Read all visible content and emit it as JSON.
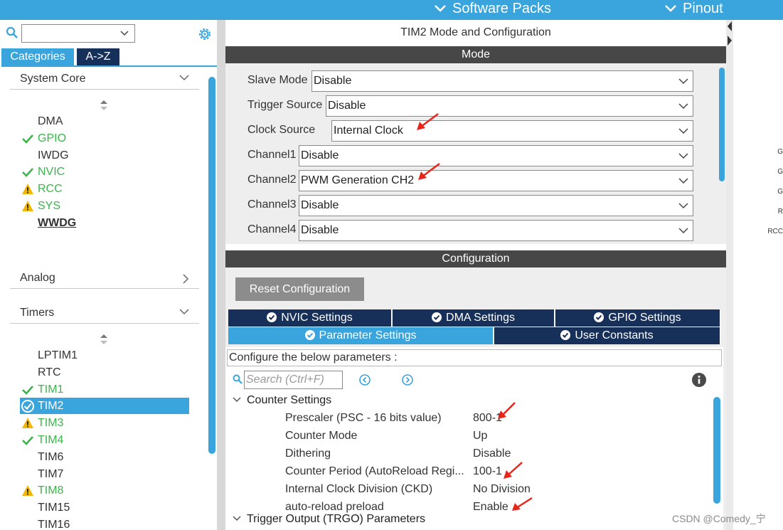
{
  "topbar": {
    "software_packs": "Software Packs",
    "pinout": "Pinout"
  },
  "left_panel": {
    "tabs": {
      "categories": "Categories",
      "az": "A->Z"
    },
    "sections": {
      "system_core": "System Core",
      "analog": "Analog",
      "timers": "Timers"
    },
    "system_core_items": [
      {
        "label": "DMA",
        "status": "normal"
      },
      {
        "label": "GPIO",
        "status": "ok"
      },
      {
        "label": "IWDG",
        "status": "normal"
      },
      {
        "label": "NVIC",
        "status": "ok"
      },
      {
        "label": "RCC",
        "status": "warning"
      },
      {
        "label": "SYS",
        "status": "warning"
      },
      {
        "label": "WWDG",
        "status": "bold"
      }
    ],
    "timer_items": [
      {
        "label": "LPTIM1",
        "status": "normal"
      },
      {
        "label": "RTC",
        "status": "normal"
      },
      {
        "label": "TIM1",
        "status": "ok"
      },
      {
        "label": "TIM2",
        "status": "selected"
      },
      {
        "label": "TIM3",
        "status": "warning"
      },
      {
        "label": "TIM4",
        "status": "ok"
      },
      {
        "label": "TIM6",
        "status": "normal"
      },
      {
        "label": "TIM7",
        "status": "normal"
      },
      {
        "label": "TIM8",
        "status": "warning"
      },
      {
        "label": "TIM15",
        "status": "normal"
      },
      {
        "label": "TIM16",
        "status": "normal"
      }
    ]
  },
  "center": {
    "title": "TIM2 Mode and Configuration",
    "mode_bar": "Mode",
    "mode_rows": [
      {
        "label": "Slave Mode",
        "value": "Disable"
      },
      {
        "label": "Trigger Source",
        "value": "Disable"
      },
      {
        "label": "Clock Source",
        "value": "Internal Clock"
      },
      {
        "label": "Channel1",
        "value": "Disable"
      },
      {
        "label": "Channel2",
        "value": "PWM Generation CH2"
      },
      {
        "label": "Channel3",
        "value": "Disable"
      },
      {
        "label": "Channel4",
        "value": "Disable"
      }
    ],
    "config_bar": "Configuration",
    "reset_button": "Reset Configuration",
    "config_tabs": {
      "nvic": "NVIC Settings",
      "dma": "DMA Settings",
      "gpio": "GPIO Settings",
      "params": "Parameter Settings",
      "user_constants": "User Constants"
    },
    "params_header": "Configure the below parameters :",
    "search_placeholder": "Search (Ctrl+F)",
    "counter_group": "Counter Settings",
    "params": [
      {
        "name": "Prescaler (PSC - 16 bits value)",
        "value": "800-1"
      },
      {
        "name": "Counter Mode",
        "value": "Up"
      },
      {
        "name": "Dithering",
        "value": "Disable"
      },
      {
        "name": "Counter Period (AutoReload Regi...",
        "value": "100-1"
      },
      {
        "name": "Internal Clock Division (CKD)",
        "value": "No Division"
      },
      {
        "name": "auto-reload preload",
        "value": "Enable"
      }
    ],
    "trgo_group": "Trigger Output (TRGO) Parameters"
  },
  "right_pins": [
    "G",
    "G",
    "G",
    "R",
    "RCC"
  ],
  "watermark": "CSDN @Comedy_宁",
  "colors": {
    "accent": "#3aa4dc",
    "navy": "#17305a",
    "ok_green": "#3cb44b",
    "warning": "#f2b705",
    "arrow_red": "#e8251b"
  }
}
